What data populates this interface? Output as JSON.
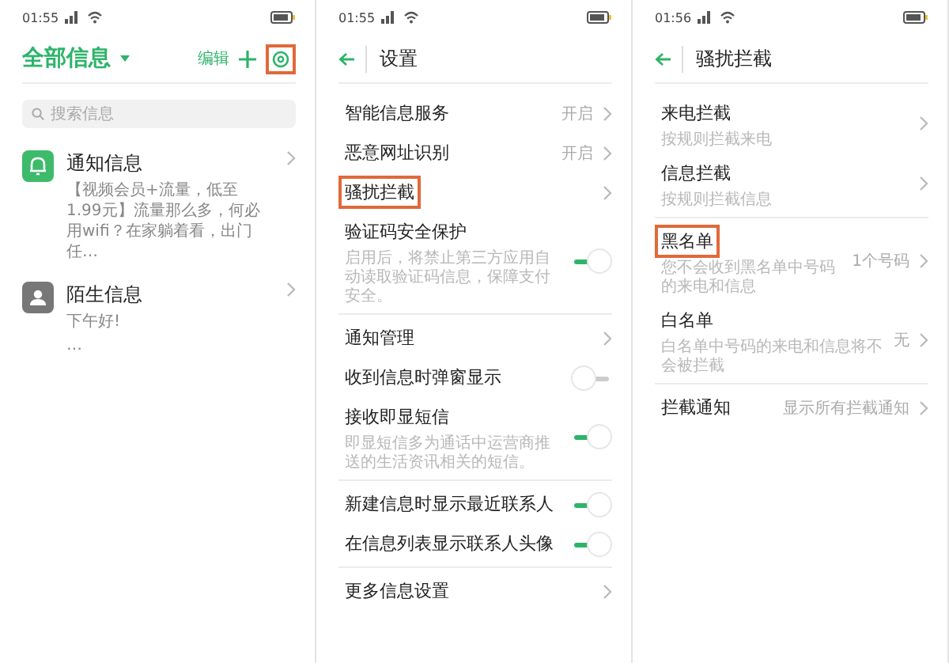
{
  "screens": [
    {
      "kind": "messages",
      "time": "01:55",
      "title": "全部信息",
      "edit": "编辑",
      "settings_button": {
        "highlighted": true
      },
      "search": {
        "placeholder": "搜索信息"
      },
      "threads": [
        {
          "kind": "notification",
          "name": "通知信息",
          "preview": "【视频会员+流量，低至1.99元】流量那么多，何必用wifi？在家躺着看，出门任…"
        },
        {
          "kind": "stranger",
          "name": "陌生信息",
          "preview": "下午好!",
          "extra": "…"
        }
      ]
    },
    {
      "kind": "settings",
      "time": "01:55",
      "title": "设置",
      "groups": [
        [
          {
            "kind": "link",
            "label": "智能信息服务",
            "value": "开启",
            "highlighted": false
          },
          {
            "kind": "link",
            "label": "恶意网址识别",
            "value": "开启",
            "highlighted": false
          },
          {
            "kind": "link",
            "label": "骚扰拦截",
            "highlighted": true
          },
          {
            "kind": "toggle",
            "label": "验证码安全保护",
            "subtitle": "启用后，将禁止第三方应用自动读取验证码信息，保障支付安全。",
            "on": true,
            "highlighted": false
          }
        ],
        [
          {
            "kind": "link",
            "label": "通知管理",
            "highlighted": false
          },
          {
            "kind": "toggle",
            "label": "收到信息时弹窗显示",
            "on": false,
            "highlighted": false
          },
          {
            "kind": "toggle",
            "label": "接收即显短信",
            "subtitle": "即显短信多为通话中运营商推送的生活资讯相关的短信。",
            "on": true,
            "highlighted": false
          }
        ],
        [
          {
            "kind": "toggle",
            "label": "新建信息时显示最近联系人",
            "on": true,
            "highlighted": false
          },
          {
            "kind": "toggle",
            "label": "在信息列表显示联系人头像",
            "on": true,
            "highlighted": false
          }
        ],
        [
          {
            "kind": "link",
            "label": "更多信息设置",
            "highlighted": false
          }
        ]
      ]
    },
    {
      "kind": "settings",
      "time": "01:56",
      "title": "骚扰拦截",
      "groups": [
        [
          {
            "kind": "link",
            "label": "来电拦截",
            "subtitle": "按规则拦截来电",
            "highlighted": false
          },
          {
            "kind": "link",
            "label": "信息拦截",
            "subtitle": "按规则拦截信息",
            "highlighted": false
          }
        ],
        [
          {
            "kind": "link",
            "label": "黑名单",
            "subtitle": "您不会收到黑名单中号码的来电和信息",
            "value": "1个号码",
            "highlighted": true
          },
          {
            "kind": "link",
            "label": "白名单",
            "subtitle": "白名单中号码的来电和信息将不会被拦截",
            "value": "无",
            "highlighted": false
          }
        ],
        [
          {
            "kind": "link",
            "label": "拦截通知",
            "value": "显示所有拦截通知",
            "highlighted": false
          }
        ]
      ]
    }
  ]
}
